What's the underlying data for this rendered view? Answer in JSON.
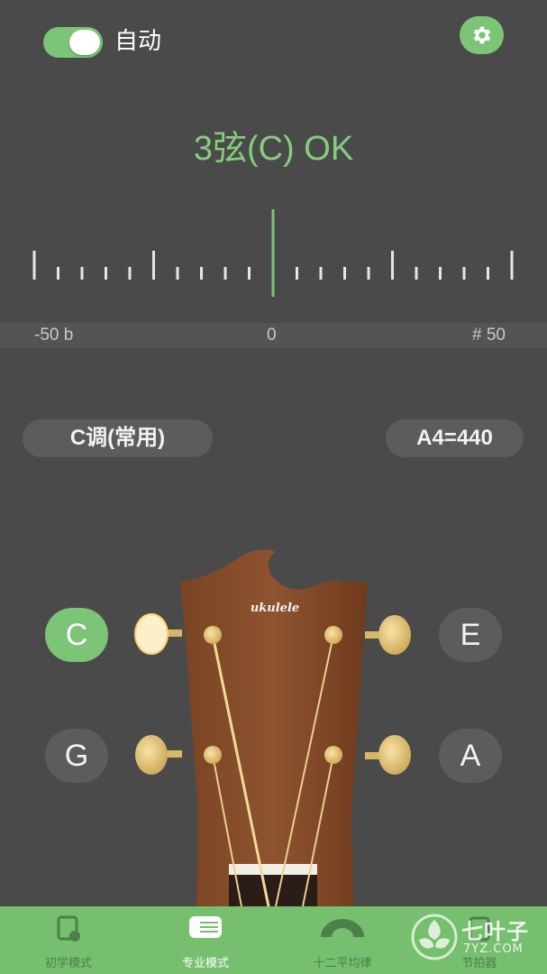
{
  "top": {
    "auto_label": "自动",
    "auto_enabled": true
  },
  "status": {
    "text": "3弦(C) OK"
  },
  "scale": {
    "left_label": "-50 b",
    "center_label": "0",
    "right_label": "# 50",
    "needle_offset": 0
  },
  "controls": {
    "key_label": "C调(常用)",
    "pitch_label": "A4=440"
  },
  "strings": {
    "top_left": "C",
    "top_right": "E",
    "bottom_left": "G",
    "bottom_right": "A",
    "active": "C"
  },
  "headstock": {
    "brand": "ukulele"
  },
  "nav": {
    "items": [
      {
        "label": "初学模式",
        "active": false
      },
      {
        "label": "专业模式",
        "active": true
      },
      {
        "label": "十二平均律",
        "active": false
      },
      {
        "label": "节拍器",
        "active": false
      }
    ]
  },
  "watermark": {
    "title": "七叶子",
    "sub": "7YZ.COM"
  },
  "colors": {
    "accent": "#7cc576",
    "background": "#4a4a4a",
    "button": "#5c5c5c"
  }
}
